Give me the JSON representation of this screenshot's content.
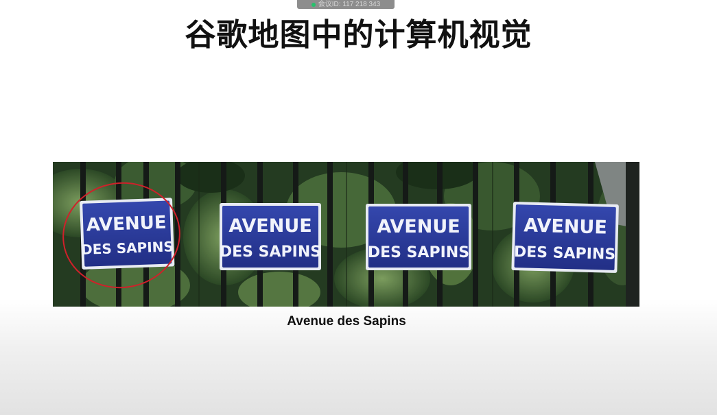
{
  "overlay": {
    "meeting_id": "会议ID: 117 218 343"
  },
  "slide": {
    "title": "谷歌地图中的计算机视觉",
    "caption": "Avenue des Sapins",
    "signs": [
      {
        "line1": "AVENUE",
        "line2": "DES SAPINS",
        "highlighted": true
      },
      {
        "line1": "AVENUE",
        "line2": "DES SAPINS",
        "highlighted": false
      },
      {
        "line1": "AVENUE",
        "line2": "DES SAPINS",
        "highlighted": false
      },
      {
        "line1": "AVENUE",
        "line2": "DES SAPINS",
        "highlighted": false
      }
    ]
  },
  "colors": {
    "sign_blue": "#2a3a9e",
    "sign_border": "#e9ecf5",
    "highlight_circle": "#d0202a",
    "foliage_dark": "#1f3a1d",
    "foliage_light": "#6b8f4e"
  }
}
